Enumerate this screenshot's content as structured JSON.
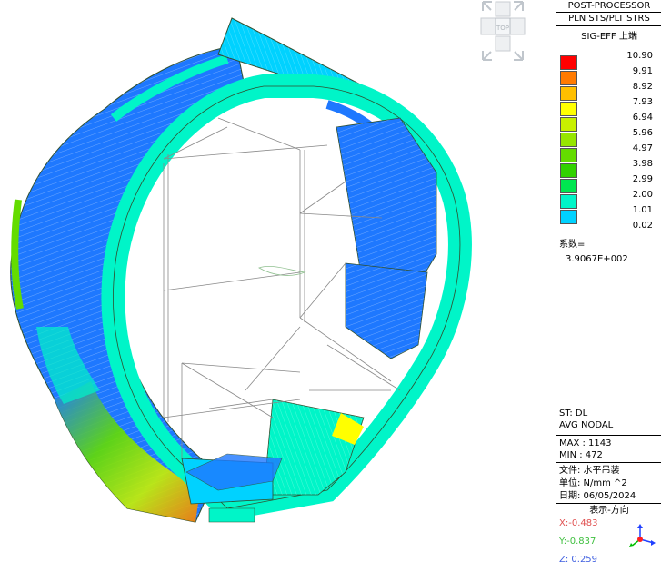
{
  "panel": {
    "title": "POST-PROCESSOR",
    "mode": "PLN STS/PLT STRS",
    "component": "SIG-EFF  上端",
    "legend": [
      {
        "value": "10.90",
        "color": "#ff0000"
      },
      {
        "value": "9.91",
        "color": "#ff7a00"
      },
      {
        "value": "8.92",
        "color": "#ffbf00"
      },
      {
        "value": "7.93",
        "color": "#ffff00"
      },
      {
        "value": "6.94",
        "color": "#c8f000"
      },
      {
        "value": "5.96",
        "color": "#96e600"
      },
      {
        "value": "4.97",
        "color": "#64dc00"
      },
      {
        "value": "3.98",
        "color": "#32d200"
      },
      {
        "value": "2.99",
        "color": "#00e650"
      },
      {
        "value": "2.00",
        "color": "#00f5c8"
      },
      {
        "value": "1.01",
        "color": "#00d2ff"
      },
      {
        "value": "0.02",
        "color": "#1e78ff"
      }
    ],
    "factor_label": "系数=",
    "factor_value": "3.9067E+002",
    "stage": "ST: DL",
    "avg": "AVG NODAL",
    "max": "MAX : 1143",
    "min": "MIN : 472",
    "file": "文件: 水平吊装",
    "unit": "单位: N/mm ^2",
    "date": "日期: 06/05/2024",
    "direction_title": "表示-方向",
    "axis_x": "X:-0.483",
    "axis_y": "Y:-0.837",
    "axis_z": "Z: 0.259"
  },
  "viewcube": {
    "label": "TOP"
  }
}
